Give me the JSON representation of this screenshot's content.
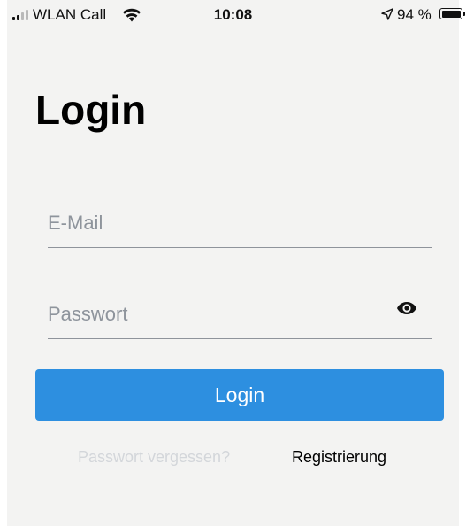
{
  "status_bar": {
    "carrier": "WLAN Call",
    "time": "10:08",
    "battery_percent": "94 %",
    "signal_bars_active": 2,
    "signal_bars_total": 4,
    "icons": [
      "signal-icon",
      "wifi-icon",
      "location-arrow-icon",
      "battery-icon"
    ]
  },
  "page": {
    "title": "Login"
  },
  "form": {
    "email": {
      "placeholder": "E-Mail",
      "value": ""
    },
    "password": {
      "placeholder": "Passwort",
      "value": "",
      "toggle_icon": "eye-icon"
    },
    "submit_label": "Login",
    "forgot_label": "Passwort vergessen?",
    "register_label": "Registrierung"
  },
  "colors": {
    "background": "#f3f3f2",
    "accent": "#2d8fe0",
    "muted_link": "#d3d6da",
    "underline": "#8e939b"
  }
}
